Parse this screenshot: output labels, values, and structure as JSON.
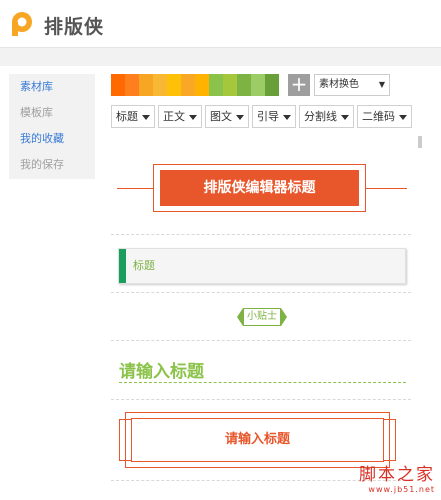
{
  "app": {
    "title": "排版侠"
  },
  "sidebar": {
    "items": [
      {
        "label": "素材库",
        "color": "#3a7bd5"
      },
      {
        "label": "模板库",
        "color": "#a0a0a0"
      },
      {
        "label": "我的收藏",
        "color": "#3a7bd5"
      },
      {
        "label": "我的保存",
        "color": "#a0a0a0"
      }
    ]
  },
  "palette": {
    "colors": [
      "#ff6a00",
      "#ff7f1f",
      "#f6a623",
      "#f8b833",
      "#ffc107",
      "#f9a825",
      "#ffb300",
      "#8bc34a",
      "#a5c73b",
      "#7cb342",
      "#9ccc65",
      "#689f38"
    ],
    "add_icon": "plus-icon",
    "select_label": "素材换色"
  },
  "tabs": [
    "标题",
    "正文",
    "图文",
    "引导",
    "分割线",
    "二维码"
  ],
  "templates": {
    "t1_title": "排版侠编辑器标题",
    "t2_label": "标题",
    "t3_tip": "小贴士",
    "t4_title": "请输入标题",
    "t5_title": "请输入标题"
  },
  "accent": {
    "orange": "#e8572c",
    "green": "#1a9e5b",
    "lime": "#8bc34a"
  },
  "watermark": {
    "main": "脚本之家",
    "sub": "www.jb51.net"
  }
}
